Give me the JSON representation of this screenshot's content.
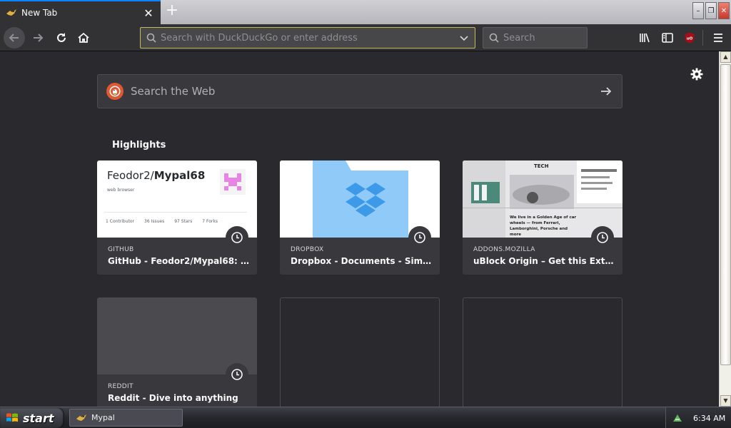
{
  "tab": {
    "title": "New Tab",
    "close_label": "✕"
  },
  "toolbar": {
    "new_tab_label": "+",
    "url_placeholder": "Search with DuckDuckGo or enter address",
    "search_placeholder": "Search"
  },
  "window_controls": {
    "minimize": "–",
    "restore": "❐",
    "close": "✕"
  },
  "newtab": {
    "web_search_placeholder": "Search the Web",
    "highlights_title": "Highlights",
    "cards": [
      {
        "source": "GITHUB",
        "title": "GitHub - Feodor2/Mypal68: web...",
        "thumb_repo_owner": "Feodor2/",
        "thumb_repo_name": "Mypal68",
        "thumb_desc": "web browser",
        "thumb_stats": [
          "1",
          "36",
          "97",
          "7"
        ],
        "thumb_stat_labels": [
          "Contributor",
          "Issues",
          "Stars",
          "Forks"
        ]
      },
      {
        "source": "DROPBOX",
        "title": "Dropbox - Documents - Simplify..."
      },
      {
        "source": "ADDONS.MOZILLA",
        "title": "uBlock Origin – Get this Extensio...",
        "thumb_heading": "TECH",
        "thumb_headline": "We live in a Golden Age of car wheels — from Ferrari, Lamborghini, Porsche and more"
      },
      {
        "source": "REDDIT",
        "title": "Reddit - Dive into anything"
      }
    ]
  },
  "taskbar": {
    "start_label": "start",
    "task_label": "Mypal",
    "clock": "6:34 AM"
  },
  "colors": {
    "accent": "#0a84ff",
    "background": "#2a2a2e",
    "card": "#38383d",
    "urlbar_border": "#c9b95a"
  }
}
